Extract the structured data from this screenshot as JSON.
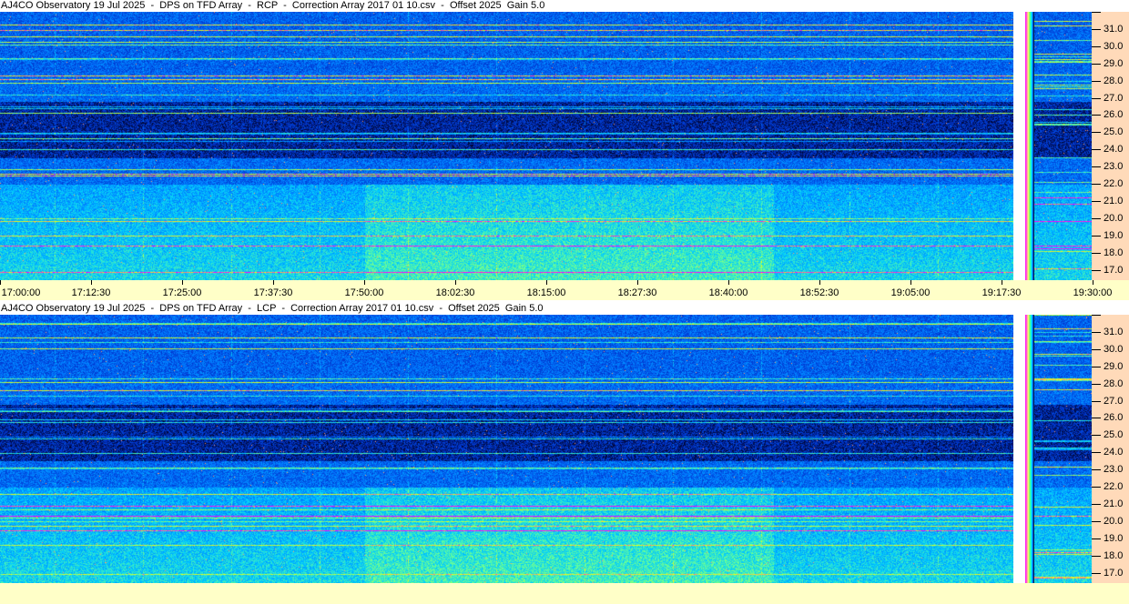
{
  "panels": [
    {
      "title": "AJ4CO Observatory 19 Jul 2025  -  DPS on TFD Array  -  RCP  -  Correction Array 2017 01 10.csv  -  Offset 2025  Gain 5.0"
    },
    {
      "title": "AJ4CO Observatory 19 Jul 2025  -  DPS on TFD Array  -  LCP  -  Correction Array 2017 01 10.csv  -  Offset 2025  Gain 5.0"
    }
  ],
  "chart_data": {
    "type": "heatmap",
    "x_ticks": [
      "17:00:00",
      "17:12:30",
      "17:25:00",
      "17:37:30",
      "17:50:00",
      "18:02:30",
      "18:15:00",
      "18:27:30",
      "18:40:00",
      "18:52:30",
      "19:05:00",
      "19:17:30",
      "19:30:00"
    ],
    "y_ticks": [
      "31.0",
      "30.0",
      "29.0",
      "28.0",
      "27.0",
      "26.0",
      "25.0",
      "24.0",
      "23.0",
      "22.0",
      "21.0",
      "20.0",
      "19.0",
      "18.0",
      "17.0"
    ],
    "xlim": [
      "17:00:00",
      "19:30:00"
    ],
    "ylim": [
      16.4,
      32.0
    ],
    "colormap": [
      "#000020",
      "#0033cc",
      "#0077ff",
      "#00ccff",
      "#66ff99",
      "#ffff00",
      "#ff00ff"
    ]
  },
  "colors": {
    "yaxis_bg": "#ffdab9",
    "taxis_bg": "#ffffc8"
  }
}
